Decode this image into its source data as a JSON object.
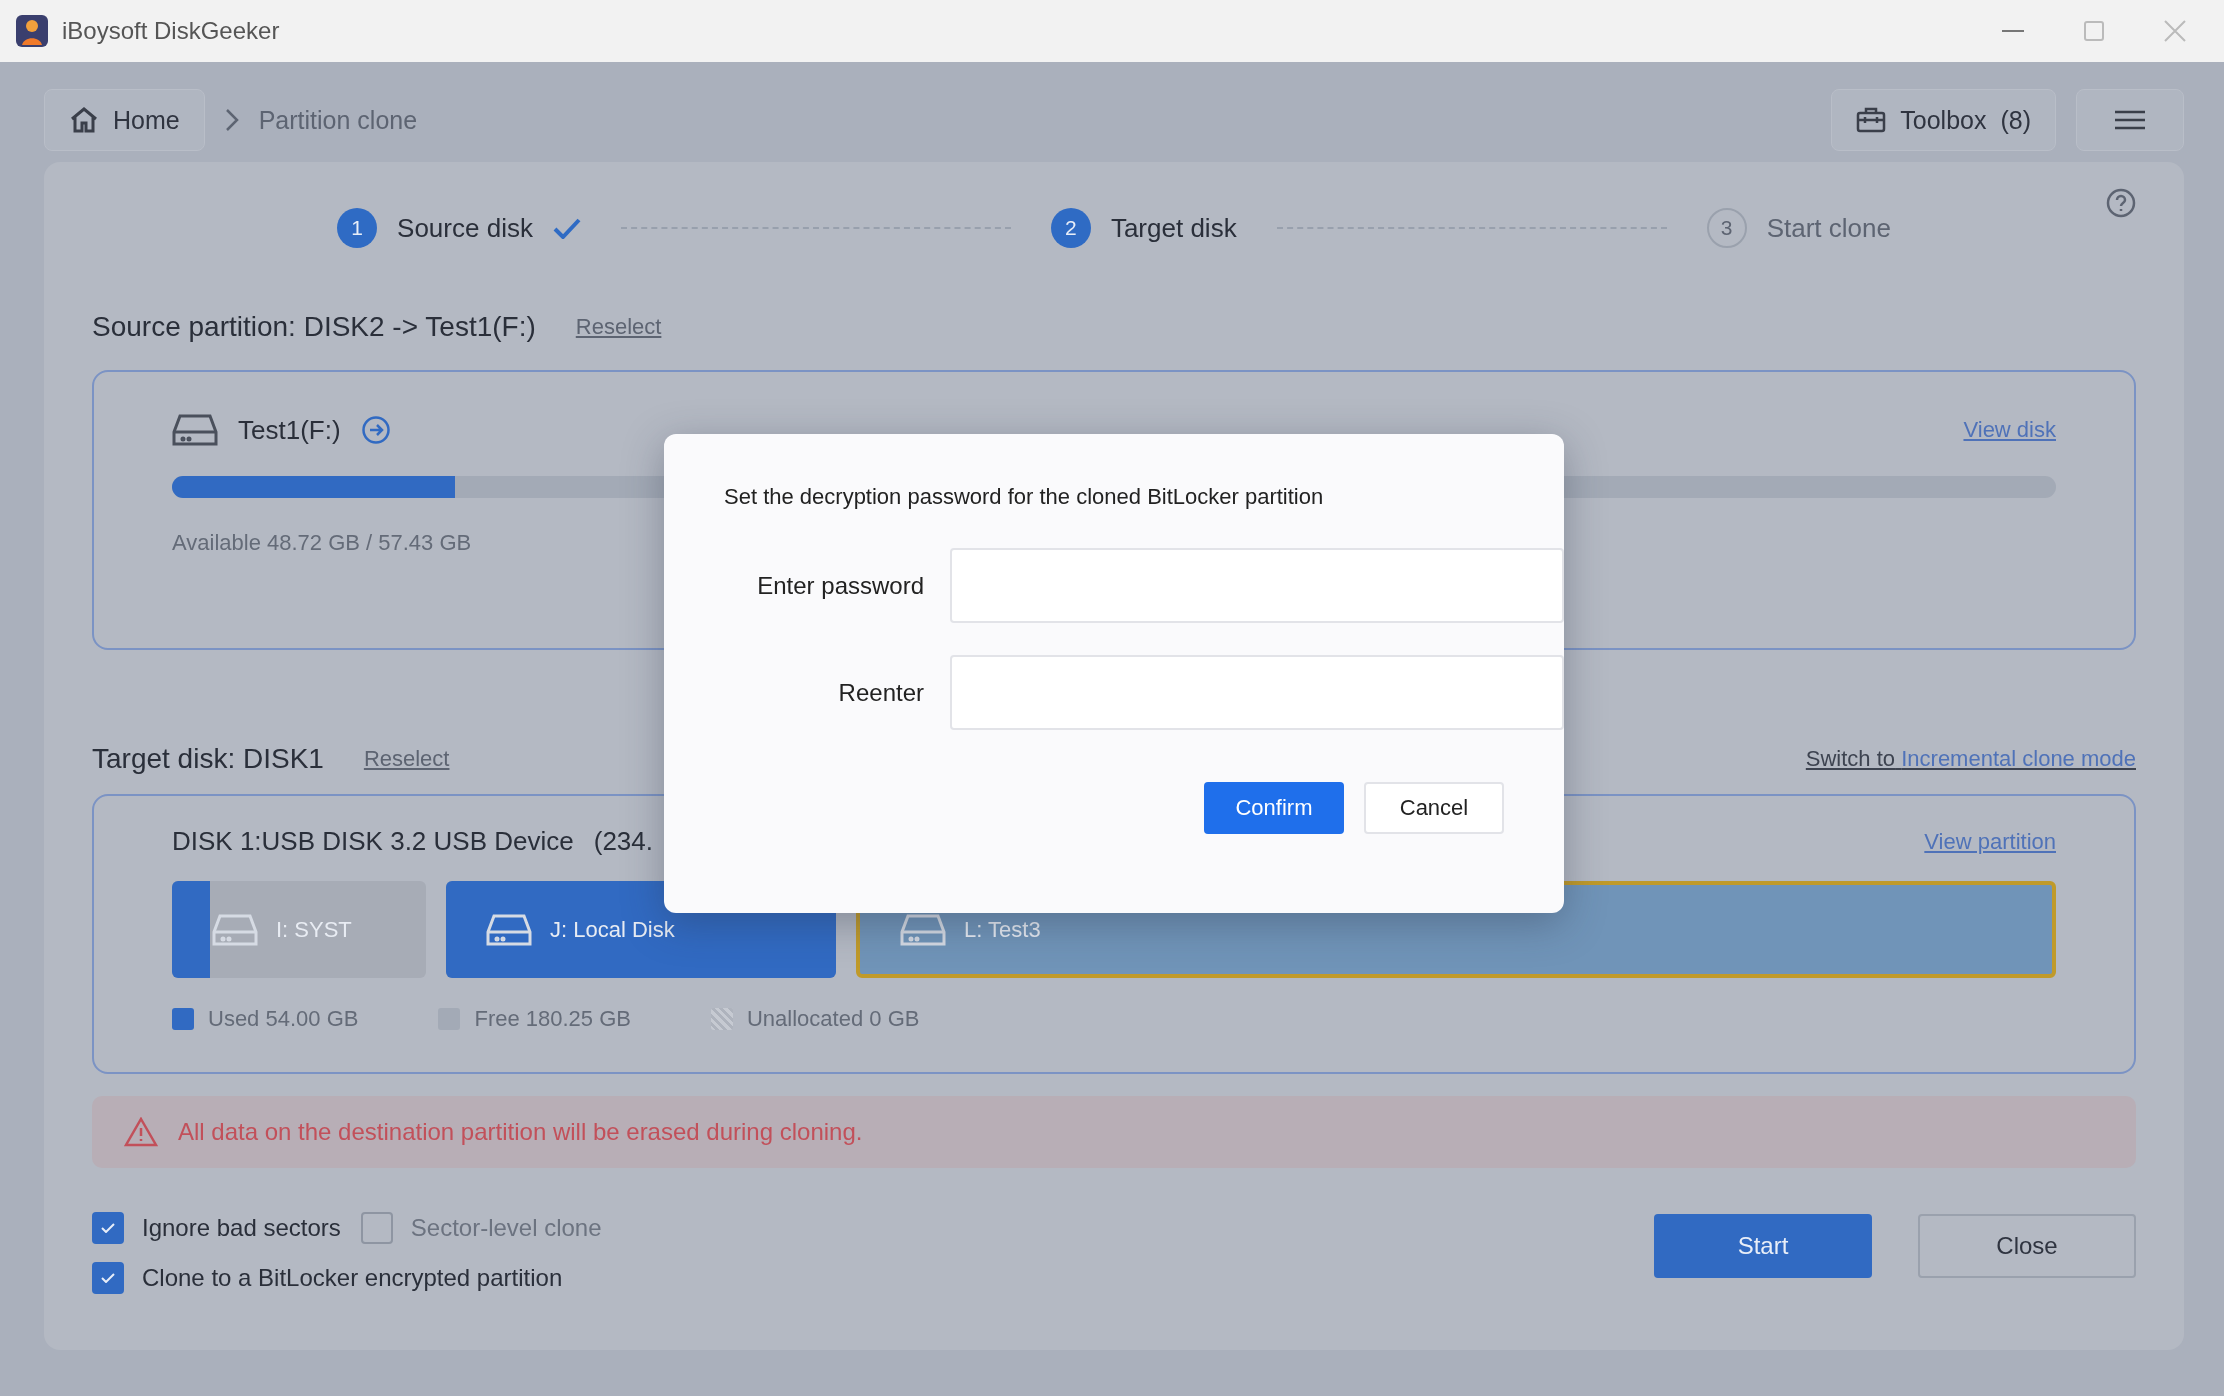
{
  "window": {
    "title": "iBoysoft DiskGeeker"
  },
  "breadcrumb": {
    "home": "Home",
    "current": "Partition clone"
  },
  "toolbox": {
    "label": "Toolbox",
    "count": "(8)"
  },
  "steps": [
    {
      "number": "1",
      "label": "Source disk",
      "reached": true,
      "done": true
    },
    {
      "number": "2",
      "label": "Target disk",
      "reached": true,
      "done": false
    },
    {
      "number": "3",
      "label": "Start clone",
      "reached": false,
      "done": false
    }
  ],
  "source": {
    "heading": "Source partition: DISK2 -> Test1(F:)",
    "reselect": "Reselect",
    "partition": "Test1(F:)",
    "view_link": "View disk",
    "level": 0.15,
    "capacity": "Available 48.72 GB / 57.43 GB"
  },
  "target": {
    "heading": "Target disk: DISK1",
    "reselect": "Reselect",
    "switch_prefix": "Switch to",
    "switch_link": "Incremental clone mode",
    "disk_name": "DISK 1:USB DISK 3.2 USB Device",
    "disk_size": "(234.",
    "view_link": "View partition",
    "partitions": [
      {
        "label": "I: SYST",
        "level": 0.15,
        "selected": false
      },
      {
        "label": "J: Local Disk",
        "level": 1,
        "selected": false
      },
      {
        "label": "L: Test3",
        "selected": true
      }
    ],
    "legend": [
      {
        "label": "Used 54.00 GB",
        "kind": "used"
      },
      {
        "label": "Free 180.25 GB",
        "kind": "free"
      },
      {
        "label": "Unallocated 0 GB",
        "kind": "unallocated"
      }
    ]
  },
  "warning": "All data on the destination partition will be erased during cloning.",
  "options": [
    [
      {
        "label": "Ignore bad sectors",
        "checked": true,
        "disabled": false
      },
      {
        "label": "Sector-level clone",
        "checked": false,
        "disabled": true
      }
    ],
    [
      {
        "label": "Clone to a BitLocker encrypted partition",
        "checked": true,
        "disabled": false
      }
    ]
  ],
  "actions": [
    {
      "label": "Start",
      "kind": "primary"
    },
    {
      "label": "Close",
      "kind": "secondary"
    }
  ],
  "dialog": {
    "title": "Set the decryption password for the cloned BitLocker partition",
    "fields": [
      {
        "label": "Enter password"
      },
      {
        "label": "Reenter"
      }
    ],
    "buttons": [
      {
        "label": "Confirm",
        "kind": "primary"
      },
      {
        "label": "Cancel",
        "kind": "secondary"
      }
    ]
  }
}
